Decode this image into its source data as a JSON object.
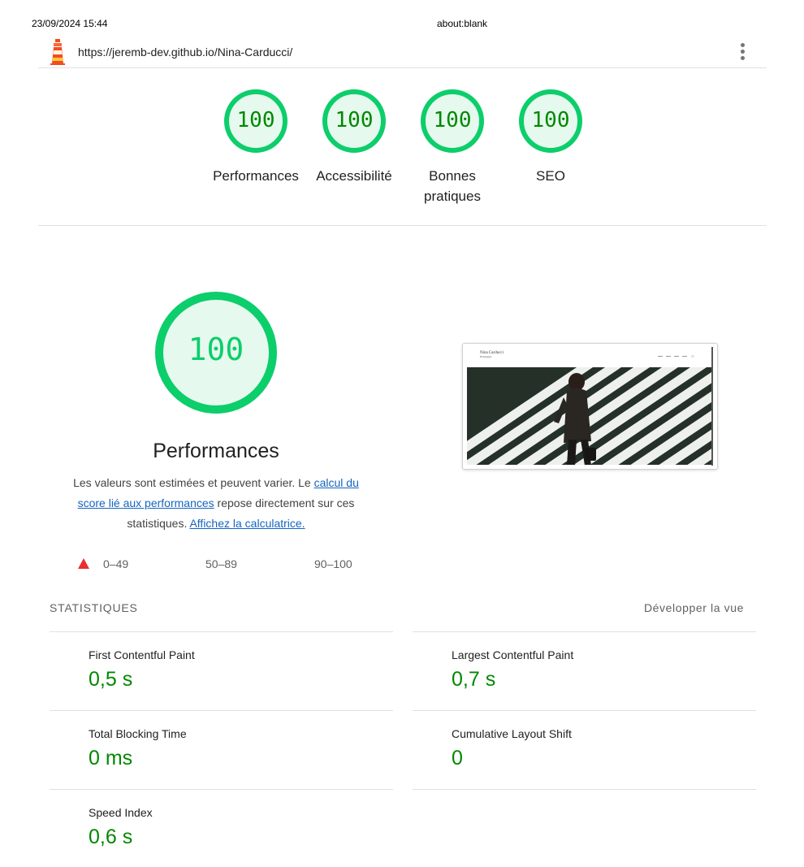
{
  "print": {
    "date": "23/09/2024 15:44",
    "title": "about:blank"
  },
  "topbar": {
    "url": "https://jeremb-dev.github.io/Nina-Carducci/",
    "logo_icon": "lighthouse-icon",
    "menu_icon": "kebab-menu-icon"
  },
  "gauges": [
    {
      "score": "100",
      "label": "Performances"
    },
    {
      "score": "100",
      "label": "Accessibilité"
    },
    {
      "score": "100",
      "label": "Bonnes pratiques"
    },
    {
      "score": "100",
      "label": "SEO"
    }
  ],
  "performance": {
    "score": "100",
    "title": "Performances",
    "desc_pre": "Les valeurs sont estimées et peuvent varier. Le ",
    "desc_link1": "calcul du score lié aux performances",
    "desc_mid": " repose directement sur ces statistiques. ",
    "desc_link2": "Affichez la calculatrice."
  },
  "legend": {
    "fail": "0–49",
    "average": "50–89",
    "pass": "90–100"
  },
  "screenshot": {
    "site_name": "Nina Carducci",
    "site_sub": "Photographe"
  },
  "stats": {
    "title": "STATISTIQUES",
    "expand": "Développer la vue",
    "metrics": [
      {
        "label": "First Contentful Paint",
        "value": "0,5 s"
      },
      {
        "label": "Largest Contentful Paint",
        "value": "0,7 s"
      },
      {
        "label": "Total Blocking Time",
        "value": "0 ms"
      },
      {
        "label": "Cumulative Layout Shift",
        "value": "0"
      },
      {
        "label": "Speed Index",
        "value": "0,6 s"
      }
    ]
  },
  "colors": {
    "pass": "#0cce6b",
    "pass_text": "#008800",
    "pass_fill": "#e6f9ee",
    "fail": "#eb2f2f"
  }
}
